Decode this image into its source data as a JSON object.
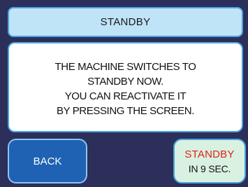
{
  "header": {
    "title": "STANDBY"
  },
  "message": {
    "lines": [
      "THE MACHINE SWITCHES TO",
      "STANDBY NOW.",
      "YOU CAN REACTIVATE IT",
      "BY PRESSING THE SCREEN."
    ]
  },
  "buttons": {
    "back_label": "BACK",
    "standby_label": "STANDBY",
    "standby_countdown": "IN 9 SEC."
  },
  "colors": {
    "background": "#2b2f5a",
    "title_bar": "#bfe3f7",
    "back_button": "#1f62b4",
    "standby_button": "#d9f1e0",
    "standby_text_red": "#e01f1f"
  }
}
